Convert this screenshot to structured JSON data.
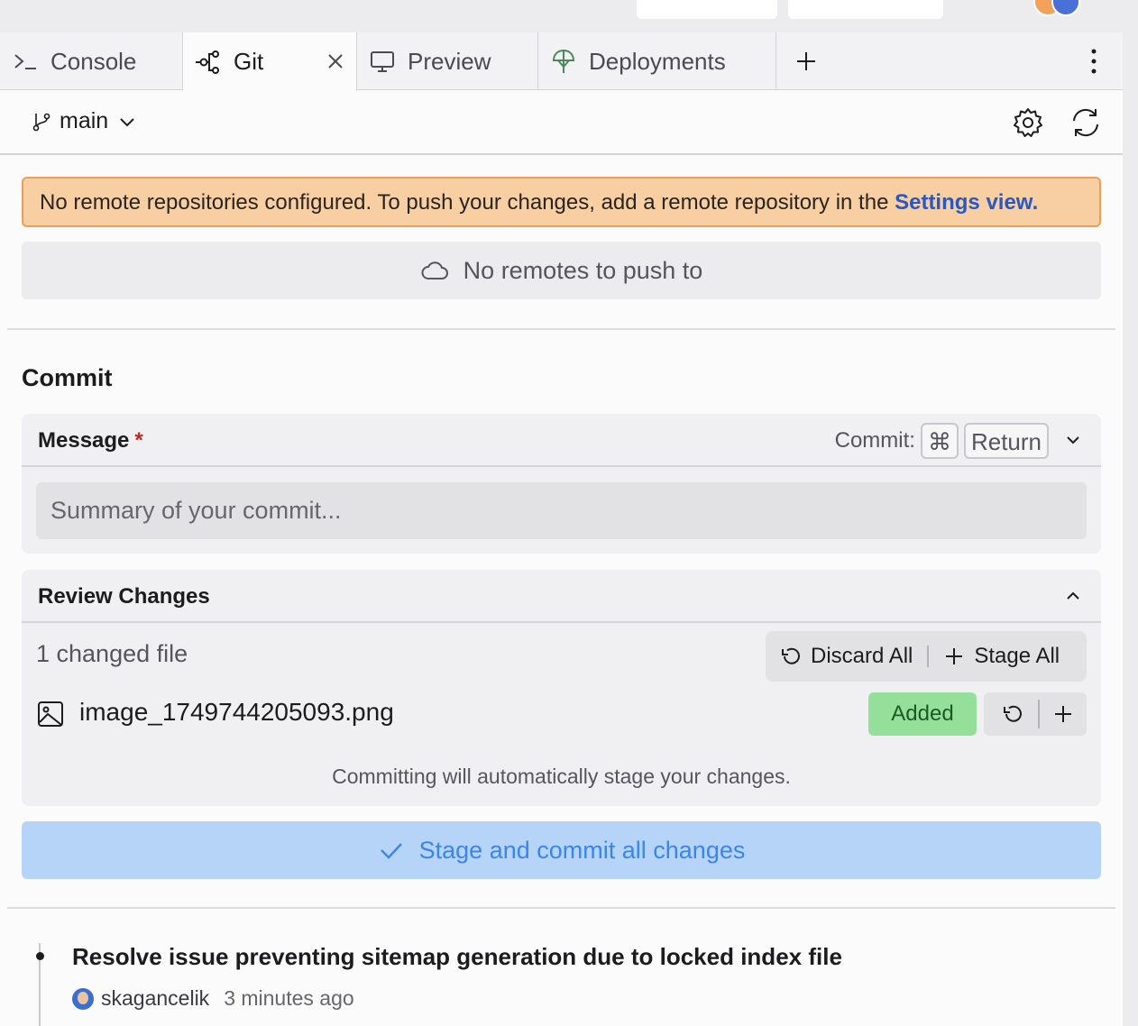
{
  "tabs": [
    {
      "label": "Console",
      "icon": "console-icon"
    },
    {
      "label": "Git",
      "icon": "git-icon",
      "active": true
    },
    {
      "label": "Preview",
      "icon": "monitor-icon"
    },
    {
      "label": "Deployments",
      "icon": "deployments-icon"
    }
  ],
  "branch": {
    "name": "main"
  },
  "warning": {
    "text": "No remote repositories configured. To push your changes, add a remote repository in the",
    "link": "Settings view."
  },
  "remotes": {
    "empty_label": "No remotes to push to"
  },
  "commit": {
    "section_title": "Commit",
    "message_label": "Message",
    "required_mark": "*",
    "shortcut_label": "Commit:",
    "shortcut_keys": [
      "⌘",
      "Return"
    ],
    "message_placeholder": "Summary of your commit..."
  },
  "review": {
    "title": "Review Changes",
    "changed_count": "1 changed file",
    "discard_all": "Discard All",
    "stage_all": "Stage All",
    "files": [
      {
        "name": "image_1749744205093.png",
        "status": "Added",
        "icon": "image-icon"
      }
    ],
    "auto_stage_note": "Committing will automatically stage your changes."
  },
  "commit_button": "Stage and commit all changes",
  "history": [
    {
      "title": "Resolve issue preventing sitemap generation due to locked index file",
      "author": "skagancelik",
      "time": "3 minutes ago"
    }
  ],
  "colors": {
    "warning_bg": "#f7cfa3",
    "warning_border": "#eaa05b",
    "link": "#2758c4",
    "added_badge": "#94e09a",
    "commit_button_bg": "#b5d4f8",
    "commit_button_text": "#3b86e8"
  }
}
